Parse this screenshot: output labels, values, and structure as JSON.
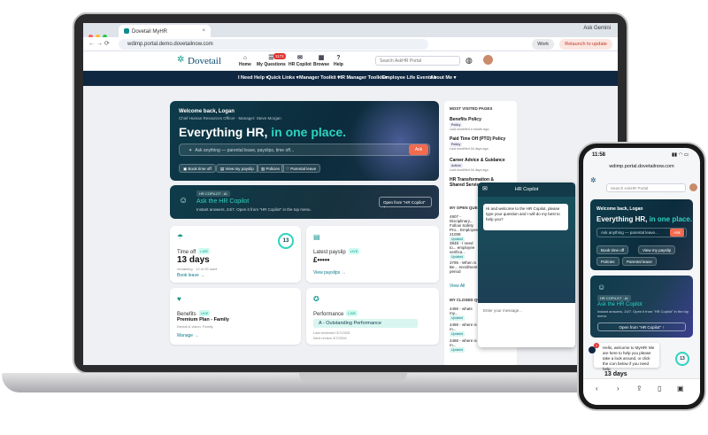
{
  "browser": {
    "tab_title": "Dovetail MyHR",
    "url": "wdimp.portal.demo.dovetailnow.com",
    "ask_gemini": "Ask Gemini",
    "work_label": "Work",
    "relaunch_label": "Relaunch to update"
  },
  "header": {
    "logo": "Dovetail",
    "nav": [
      {
        "label": "Home",
        "icon": "home-icon"
      },
      {
        "label": "My Questions",
        "icon": "questions-icon",
        "badge": "1173"
      },
      {
        "label": "HR Copilot",
        "icon": "copilot-icon"
      },
      {
        "label": "Browse",
        "icon": "browse-icon"
      },
      {
        "label": "Help",
        "icon": "help-icon"
      }
    ],
    "search_placeholder": "Search AskHR Portal"
  },
  "menu": [
    "I Need Help",
    "Quick Links",
    "Manager Toolkit",
    "HR Manager Toolkit",
    "Employee Life Events",
    "About Me"
  ],
  "hero": {
    "welcome": "Welcome back, Logan",
    "role": "Chief Human Resources Officer · Manager: Steve Morgan",
    "headline_a": "Everything HR, ",
    "headline_b": "in one place.",
    "search_placeholder": "Ask anything — parental leave, payslips, time off...",
    "ask_label": "Ask",
    "chips": [
      "Book time off",
      "View my payslip",
      "Policies",
      "Parental leave"
    ]
  },
  "copilot_card": {
    "badge": "HR COPILOT · AI",
    "title": "Ask the HR Copilot",
    "subtitle": "Instant answers, 24/7. Open it from \"HR Copilot\" in the top menu.",
    "button": "Open from \"HR Copilot\" ↑"
  },
  "cards": {
    "timeoff": {
      "label": "Time off",
      "live": "LIVE",
      "value": "13 days",
      "sub": "remaining · 12 of 25 used",
      "link": "Book leave →",
      "ring": "13"
    },
    "payslip": {
      "label": "Latest payslip",
      "live": "LIVE",
      "value": "£•••••",
      "link": "View payslips →"
    },
    "benefits": {
      "label": "Benefits",
      "live": "LIVE",
      "plan": "Premium Plan - Family",
      "sub": "Dental & vision, Family",
      "link": "Manage →"
    },
    "performance": {
      "label": "Performance",
      "live": "LIVE",
      "rating": "A - Outstanding Performance",
      "reviewed": "Last reviewed 3/7/2025",
      "next": "Next review 3/7/2026"
    }
  },
  "most_visited": {
    "title": "MOST VISITED PAGES",
    "items": [
      {
        "title": "Benefits Policy",
        "tag": "Policy",
        "date": "Last modified a month ago"
      },
      {
        "title": "Paid Time Off (PTO) Policy",
        "tag": "Policy",
        "date": "Last modified 16 days ago"
      },
      {
        "title": "Career Advice & Guidance",
        "tag": "Article",
        "date": "Last modified 16 days ago"
      },
      {
        "title": "HR Transformation & Shared Services",
        "tag": "",
        "date": ""
      }
    ],
    "open_title": "MY OPEN QUESTIONS",
    "open_items": [
      "4907 - Disciplinary... Follow Safety Pro... Employee 21008",
      "3848 - I need to... employee verifica...",
      "3795 - When is Be... enrollment period"
    ],
    "updated": "Updated",
    "view_all": "View All",
    "closed_title": "MY CLOSED QUESTIONS",
    "closed_items": [
      "4486 - whats my...",
      "4486 - where is m...",
      "4486 - where is m..."
    ]
  },
  "popup": {
    "title": "HR Copilot",
    "greeting": "Hi and welcome to the HR Copilot, please type your question and I will do my best to help you?",
    "input_placeholder": "Enter your message..."
  },
  "phone": {
    "time": "11:58",
    "url": "wdimp.portal.dovetailnow.com",
    "search": "Search AskHR Portal",
    "welcome": "Welcome back, Logan",
    "headline_a": "Everything HR, ",
    "headline_b": "in one place.",
    "search_hint": "Ask anything — parental leave...",
    "ask": "Ask",
    "chips": [
      "Book time off",
      "View my payslip",
      "Policies",
      "Parental leave"
    ],
    "cp_badge": "HR COPILOT · AI",
    "cp_title": "Ask the HR Copilot",
    "cp_sub": "Instant answers, 24/7. Open it from \"HR Copilot\" in the top menu.",
    "cp_button": "Open from \"HR Copilot\" ↑",
    "chat": "Hello, welcome to MyHR! We are here to help you please take a look around, or click the icon below if you need help.",
    "chat_badge": "1",
    "days": "13 days",
    "ring": "13"
  }
}
